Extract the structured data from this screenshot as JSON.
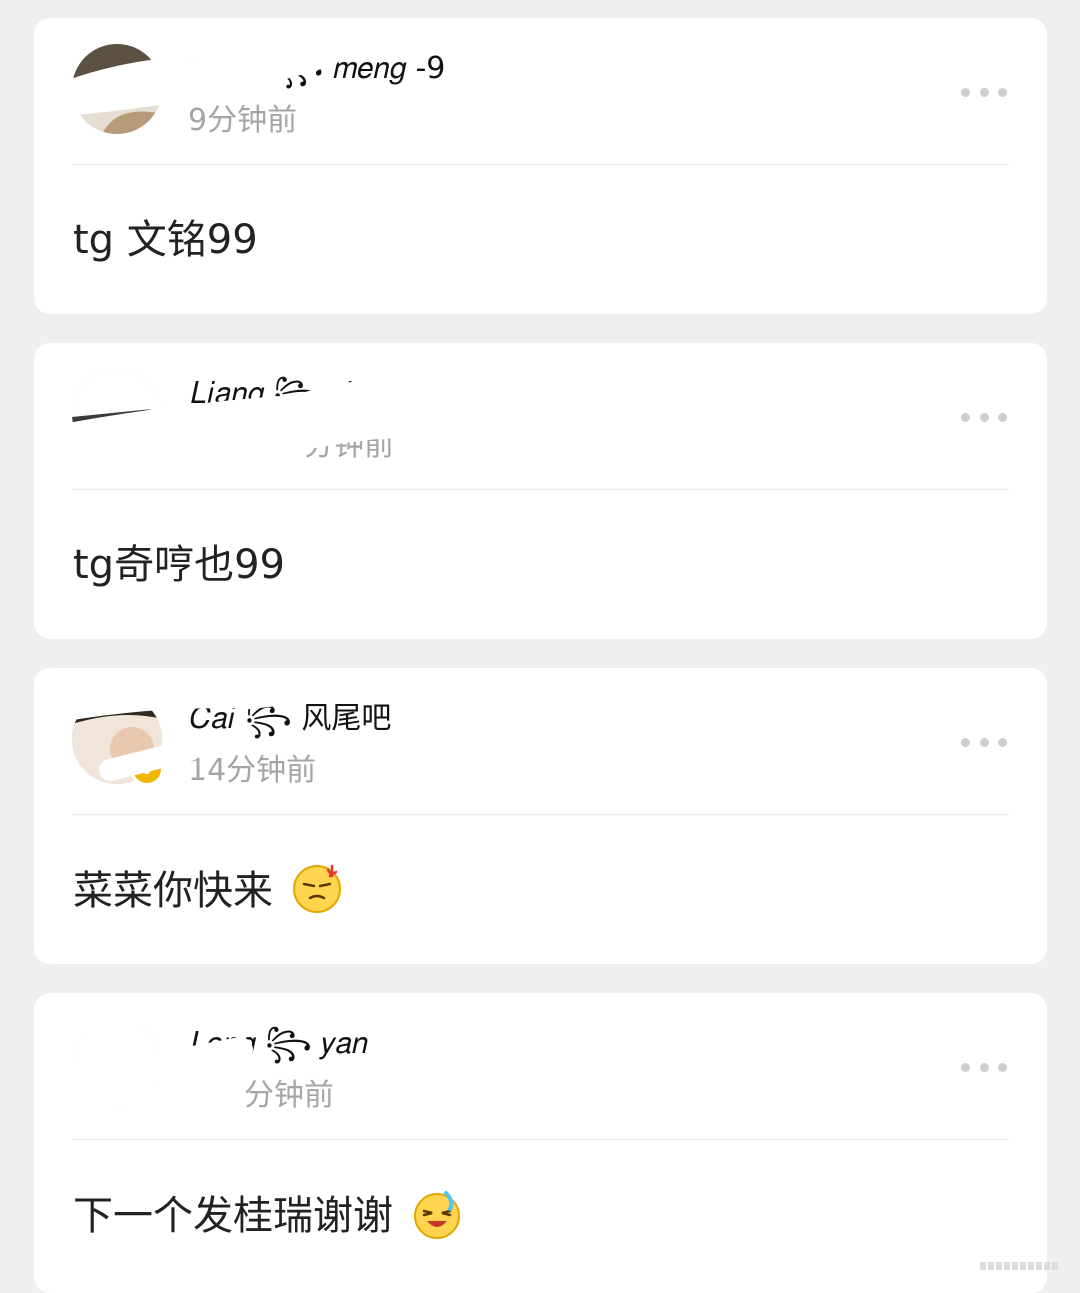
{
  "posts": [
    {
      "username": "𝑊𝑎𝑛𝑔 ꧂ 𝑚𝑒𝑛𝑔 -9",
      "time": "9分钟前",
      "content": "tg 文铭99",
      "verified": false,
      "avatar_icon": "user-avatar-icon",
      "emoji": null
    },
    {
      "username": "𝐿𝑖𝑎𝑛𝑔 ꧂ 𝑦𝑖 -9",
      "time": "分钟前",
      "content": "tg奇哼也99",
      "verified": false,
      "avatar_icon": "user-avatar-icon",
      "emoji": null
    },
    {
      "username": "𝐶𝑎𝑖 ꧂ 风尾吧",
      "time": "14分钟前",
      "content": "菜菜你快来",
      "verified": true,
      "avatar_icon": "user-avatar-icon",
      "emoji": "angry-face-emoji"
    },
    {
      "username": "𝐿𝑜𝑛𝑔 ꧂ 𝑦𝑎𝑛",
      "time": "分钟前",
      "content": "下一个发桂瑞谢谢",
      "verified": false,
      "avatar_icon": "user-avatar-icon",
      "emoji": "crying-laugh-emoji"
    }
  ],
  "more_icon": "more-dots-icon",
  "verify_label": "V",
  "colors": {
    "background": "#efefef",
    "card": "#ffffff",
    "time_text": "#a5a5a5",
    "badge": "#f2b600"
  }
}
